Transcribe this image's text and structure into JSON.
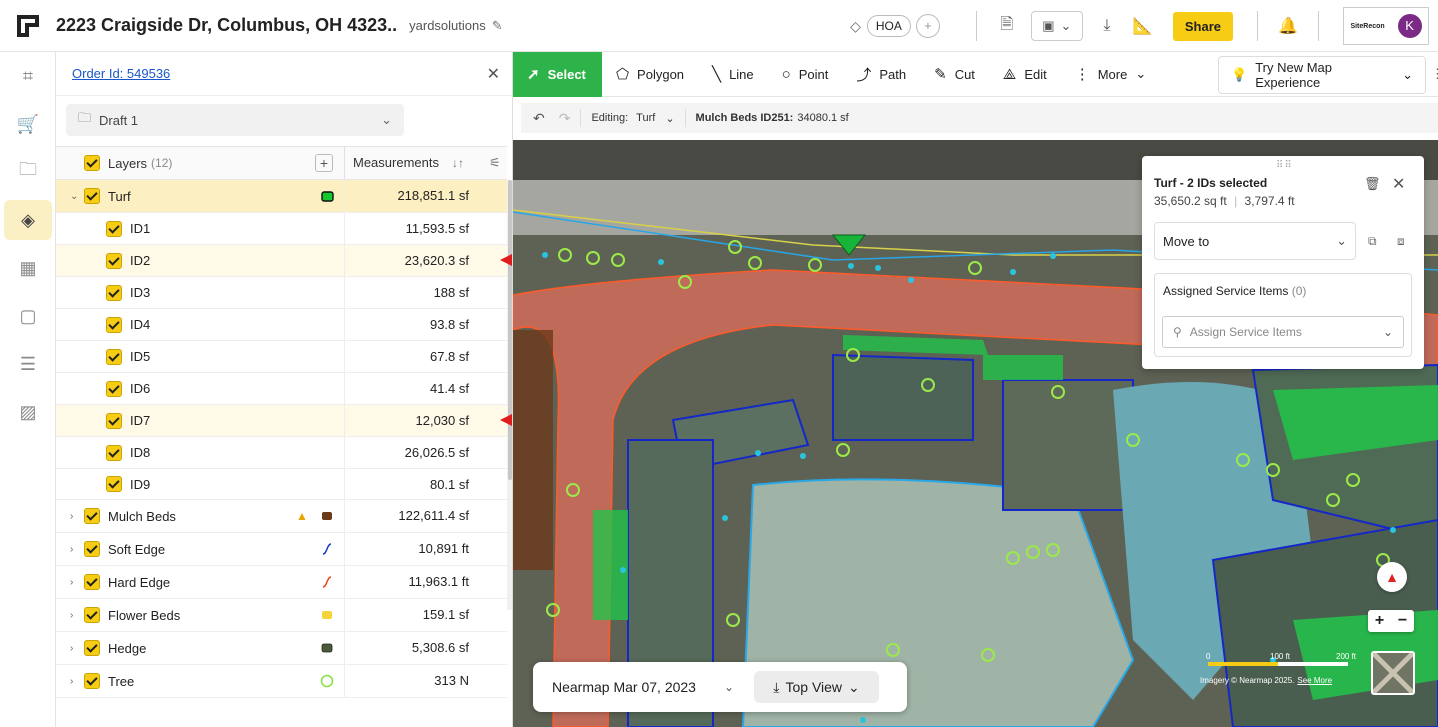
{
  "header": {
    "address": "2223 Craigside Dr, Columbus, OH 4323..",
    "company": "yardsolutions",
    "tag": "HOA",
    "share_label": "Share",
    "brand": "SiteRecon",
    "avatar_letter": "K"
  },
  "panel": {
    "order_link": "Order Id: 549536",
    "draft": "Draft 1",
    "layers_header": "Layers",
    "layers_count": "(12)",
    "measurements_header": "Measurements",
    "rows": [
      {
        "name": "Turf",
        "value": "218,851.1 sf"
      },
      {
        "name": "ID1",
        "value": "11,593.5 sf"
      },
      {
        "name": "ID2",
        "value": "23,620.3 sf"
      },
      {
        "name": "ID3",
        "value": "188 sf"
      },
      {
        "name": "ID4",
        "value": "93.8 sf"
      },
      {
        "name": "ID5",
        "value": "67.8 sf"
      },
      {
        "name": "ID6",
        "value": "41.4 sf"
      },
      {
        "name": "ID7",
        "value": "12,030 sf"
      },
      {
        "name": "ID8",
        "value": "26,026.5 sf"
      },
      {
        "name": "ID9",
        "value": "80.1 sf"
      },
      {
        "name": "Mulch Beds",
        "value": "122,611.4 sf"
      },
      {
        "name": "Soft Edge",
        "value": "10,891 ft"
      },
      {
        "name": "Hard Edge",
        "value": "11,963.1 ft"
      },
      {
        "name": "Flower Beds",
        "value": "159.1 sf"
      },
      {
        "name": "Hedge",
        "value": "5,308.6 sf"
      },
      {
        "name": "Tree",
        "value": "313 N"
      }
    ]
  },
  "toolbar": {
    "tools": [
      "Select",
      "Polygon",
      "Line",
      "Point",
      "Path",
      "Cut",
      "Edit",
      "More"
    ],
    "try_new": "Try New Map Experience"
  },
  "subbar": {
    "editing_label": "Editing:",
    "editing_value": "Turf",
    "info_label": "Mulch Beds ID251:",
    "info_value": "34080.1 sf"
  },
  "selection": {
    "title": "Turf - 2 IDs selected",
    "area": "35,650.2 sq ft",
    "perimeter": "3,797.4 ft",
    "move_to": "Move to",
    "assigned_label": "Assigned Service Items",
    "assigned_count": "(0)",
    "assign_placeholder": "Assign Service Items"
  },
  "map": {
    "imagery_date": "Nearmap Mar 07, 2023",
    "view": "Top View",
    "scale_0": "0",
    "scale_1": "100 ft",
    "scale_2": "200 ft",
    "credit": "Imagery © Nearmap 2025.",
    "credit_link": "See More"
  }
}
